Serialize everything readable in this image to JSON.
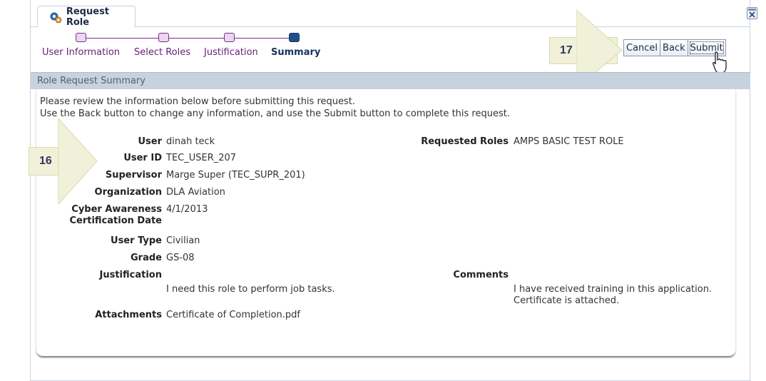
{
  "tab": {
    "title": "Request Role"
  },
  "train": {
    "steps": [
      {
        "label": "User Information"
      },
      {
        "label": "Select Roles"
      },
      {
        "label": "Justification"
      },
      {
        "label": "Summary"
      }
    ]
  },
  "callouts": {
    "left": "16",
    "right": "17"
  },
  "buttons": {
    "cancel": "Cancel",
    "back": "Back",
    "submit": "Submit"
  },
  "section": {
    "header": "Role Request Summary"
  },
  "intro": {
    "line1": "Please review the information below before submitting this request.",
    "line2": "Use the Back button to change any information, and use the Submit button to complete this request."
  },
  "fields": {
    "user": {
      "label": "User",
      "value": "dinah teck"
    },
    "user_id": {
      "label": "User ID",
      "value": "TEC_USER_207"
    },
    "supervisor": {
      "label": "Supervisor",
      "value": "Marge Super (TEC_SUPR_201)"
    },
    "organization": {
      "label": "Organization",
      "value": "DLA Aviation"
    },
    "cyber": {
      "label_line1": "Cyber Awareness",
      "label_line2": "Certification Date",
      "value": "4/1/2013"
    },
    "user_type": {
      "label": "User Type",
      "value": "Civilian"
    },
    "grade": {
      "label": "Grade",
      "value": "GS-08"
    },
    "justification": {
      "label": "Justification",
      "value": "I need this role to perform job tasks."
    },
    "attachments": {
      "label": "Attachments",
      "value": "Certificate of Completion.pdf"
    },
    "requested_roles": {
      "label": "Requested Roles",
      "value": "AMPS BASIC TEST ROLE"
    },
    "comments": {
      "label": "Comments",
      "value_line1": "I have received training in this application.",
      "value_line2": "Certificate is attached."
    }
  },
  "colors": {
    "train_visited": "#7e2b8a",
    "train_current": "#1f4f86",
    "section_header_bg": "#c6d2de",
    "callout_bg": "#f0f1d8"
  },
  "icons": {
    "tab": "gears-icon",
    "close": "close-window-icon",
    "cursor": "mouse-pointer-icon"
  }
}
